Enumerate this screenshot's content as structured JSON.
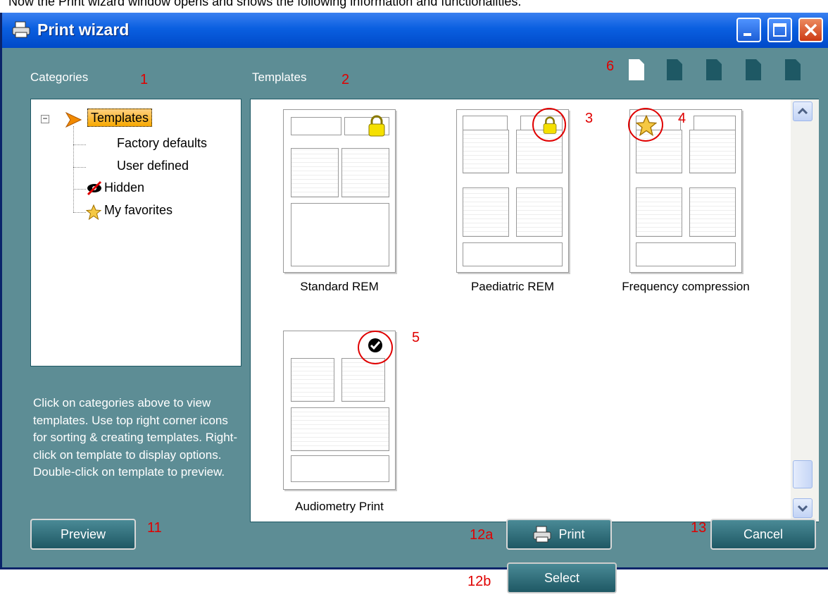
{
  "intro_text": "Now the Print wizard window opens and shows the following information and functionalities:",
  "window": {
    "title": "Print wizard",
    "icons": [
      "printer-icon",
      "minimize-icon",
      "maximize-icon",
      "close-icon"
    ]
  },
  "categories": {
    "heading": "Categories",
    "tree": [
      {
        "label": "Templates",
        "icon": "arrow-right-icon",
        "selected": true
      },
      {
        "label": "Factory defaults"
      },
      {
        "label": "User defined"
      },
      {
        "label": "Hidden",
        "icon": "hidden-eye-icon"
      },
      {
        "label": "My favorites",
        "icon": "star-icon"
      }
    ],
    "help": "Click on categories above to view templates. Use top right corner icons for sorting & creating templates. Right-click on template to display options. Double-click on template to preview."
  },
  "templates": {
    "heading": "Templates",
    "items": [
      {
        "name": "Standard REM",
        "badge": "lock-icon"
      },
      {
        "name": "Paediatric REM",
        "badge": "lock-icon"
      },
      {
        "name": "Frequency compression",
        "badge": "star-icon"
      },
      {
        "name": "Audiometry Print",
        "badge": "check-icon"
      }
    ]
  },
  "buttons": {
    "preview": "Preview",
    "print": "Print",
    "cancel": "Cancel",
    "select": "Select"
  },
  "annotations": [
    "1",
    "2",
    "3",
    "4",
    "5",
    "6",
    "11",
    "12a",
    "13",
    "12b"
  ],
  "colors": {
    "window_bg": "#5d8d95",
    "titlebar": "#0a5fe0",
    "button": "#1e5864",
    "annotation": "#e00000",
    "selection": "#f7a800"
  }
}
